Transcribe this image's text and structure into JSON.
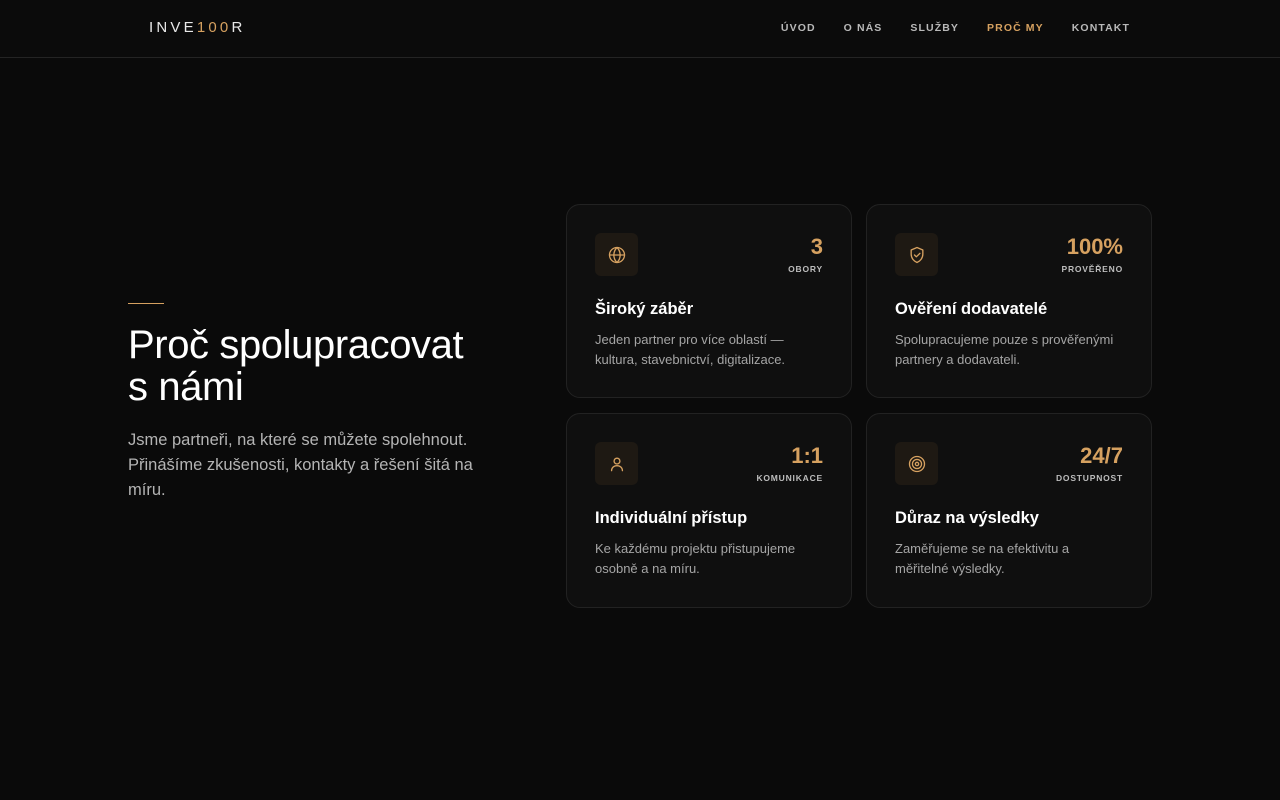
{
  "header": {
    "logo_prefix": "INVE",
    "logo_accent": "100",
    "logo_suffix": "R",
    "nav": [
      {
        "label": "ÚVOD"
      },
      {
        "label": "O NÁS"
      },
      {
        "label": "SLUŽBY"
      },
      {
        "label": "PROČ MY",
        "active": true
      },
      {
        "label": "KONTAKT"
      }
    ]
  },
  "hero": {
    "title_line1": "Proč spolupracovat",
    "title_line2": "s námi",
    "description": "Jsme partneři, na které se můžete spolehnout. Přinášíme zkušenosti, kontakty a řešení šitá na míru."
  },
  "cards": [
    {
      "icon": "globe-icon",
      "stat_value": "3",
      "stat_label": "OBORY",
      "title": "Široký záběr",
      "description": "Jeden partner pro více oblastí — kultura, stavebnictví, digitalizace."
    },
    {
      "icon": "shield-check-icon",
      "stat_value": "100%",
      "stat_label": "PROVĚŘENO",
      "title": "Ověření dodavatelé",
      "description": "Spolupracujeme pouze s prověřenými partnery a dodavateli."
    },
    {
      "icon": "user-icon",
      "stat_value": "1:1",
      "stat_label": "KOMUNIKACE",
      "title": "Individuální přístup",
      "description": "Ke každému projektu přistupujeme osobně a na míru."
    },
    {
      "icon": "target-icon",
      "stat_value": "24/7",
      "stat_label": "DOSTUPNOST",
      "title": "Důraz na výsledky",
      "description": "Zaměřujeme se na efektivitu a měřitelné výsledky."
    }
  ],
  "colors": {
    "background": "#0a0a0a",
    "accent": "#d6a160",
    "card_background": "#0f0f0f",
    "card_border": "#222222"
  }
}
